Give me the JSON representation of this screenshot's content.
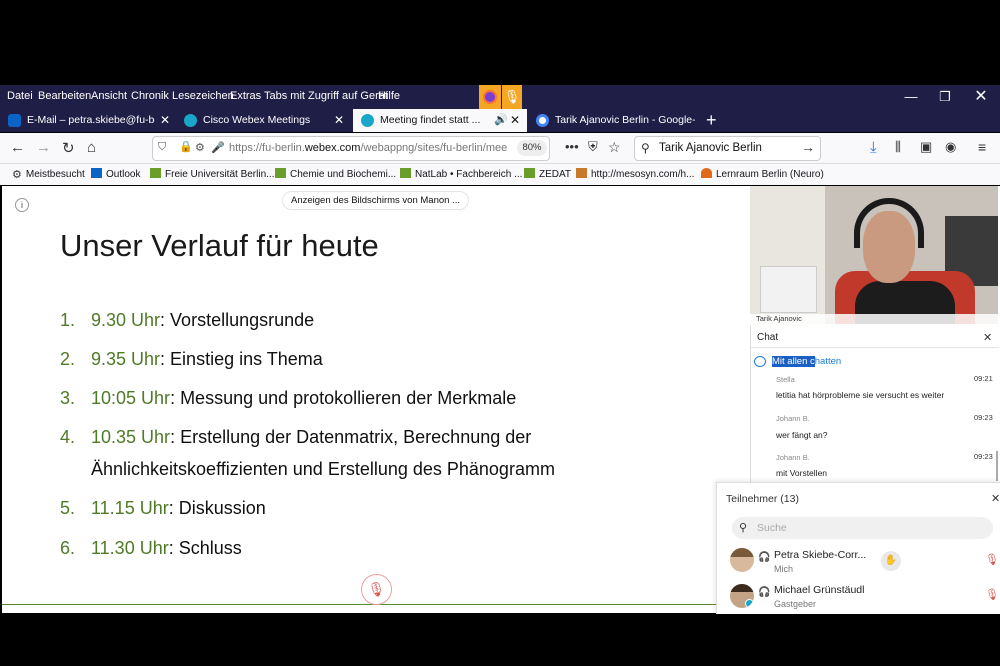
{
  "menubar": {
    "items": [
      "Datei",
      "Bearbeiten",
      "Ansicht",
      "Chronik",
      "Lesezeichen",
      "Extras",
      "Tabs mit Zugriff auf Gerät",
      "Hilfe"
    ]
  },
  "tabs": [
    {
      "label": "E-Mail – petra.skiebe@fu-berlin"
    },
    {
      "label": "Cisco Webex Meetings"
    },
    {
      "label": "Meeting findet statt ..."
    },
    {
      "label": "Tarik Ajanovic Berlin - Google-S"
    }
  ],
  "nav": {
    "url_prefix": "https://fu-berlin.",
    "url_domain": "webex.com",
    "url_suffix": "/webappng/sites/fu-berlin/mee",
    "zoom": "80%",
    "search_value": "Tarik Ajanovic Berlin"
  },
  "bookmarks": [
    "Meistbesucht",
    "Outlook",
    "Freie Universität Berlin...",
    "Chemie und Biochemi...",
    "NatLab • Fachbereich ...",
    "ZEDAT",
    "http://mesosyn.com/h...",
    "Lernraum Berlin (Neuro)"
  ],
  "share_banner": "Anzeigen des Bildschirms von Manon ...",
  "slide": {
    "title": "Unser Verlauf für heute",
    "items": [
      {
        "num": "1.",
        "time": "9.30 Uhr",
        "text": ": Vorstellungsrunde"
      },
      {
        "num": "2.",
        "time": "9.35 Uhr",
        "text": ": Einstieg ins Thema"
      },
      {
        "num": "3.",
        "time": "10:05 Uhr",
        "text": ": Messung und protokollieren der Merkmale"
      },
      {
        "num": "4.",
        "time": "10.35 Uhr",
        "text": ": Erstellung der Datenmatrix, Berechnung der",
        "text2": "Ähnlichkeitskoeffizienten und Erstellung des Phänogramm"
      },
      {
        "num": "5.",
        "time": "11.15 Uhr",
        "text": ": Diskussion"
      },
      {
        "num": "6.",
        "time": "11.30 Uhr",
        "text": ": Schluss"
      }
    ]
  },
  "video": {
    "name": "Tarik Ajanovic"
  },
  "chat": {
    "title": "Chat",
    "to_label_selected": "Mit allen c",
    "to_label_rest": "hatten",
    "messages": [
      {
        "sender": "Stella",
        "time": "09:21",
        "text": "letitia hat hörprobleme sie versucht es weiter"
      },
      {
        "sender": "Johann B.",
        "time": "09:23",
        "text": "wer fängt an?"
      },
      {
        "sender": "Johann B.",
        "time": "09:23",
        "text": "mit Vorstellen"
      }
    ]
  },
  "participants": {
    "title": "Teilnehmer (13)",
    "search_placeholder": "Suche",
    "list": [
      {
        "name": "Petra Skiebe-Corr...",
        "role": "Mich"
      },
      {
        "name": "Michael Grünstäudl",
        "role": "Gastgeber"
      }
    ]
  },
  "colors": {
    "accent_green": "#4f7a28",
    "mute_red": "#d9534f",
    "titlebar": "#1f1e47"
  }
}
